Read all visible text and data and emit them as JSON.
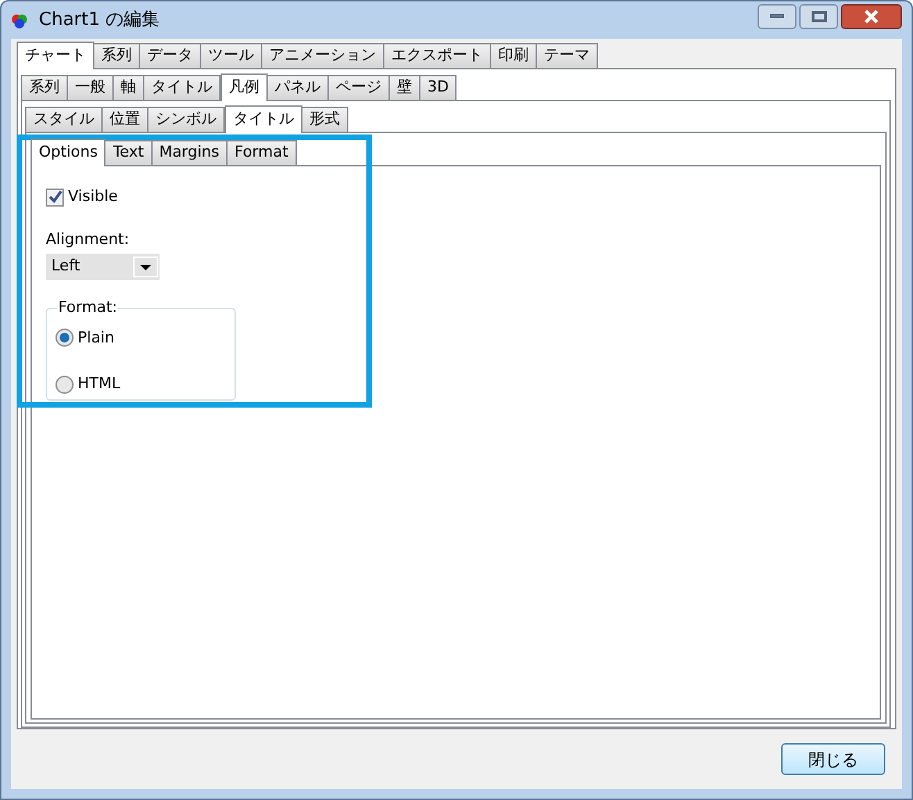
{
  "window": {
    "title": "Chart1 の編集"
  },
  "tabs": [
    {
      "label": "チャート",
      "selected": true
    },
    {
      "label": "系列",
      "selected": false
    },
    {
      "label": "データ",
      "selected": false
    },
    {
      "label": "ツール",
      "selected": false
    },
    {
      "label": "アニメーション",
      "selected": false
    },
    {
      "label": "エクスポート",
      "selected": false
    },
    {
      "label": "印刷",
      "selected": false
    },
    {
      "label": "テーマ",
      "selected": false
    }
  ],
  "chart_tabs": [
    {
      "label": "系列",
      "selected": false
    },
    {
      "label": "一般",
      "selected": false
    },
    {
      "label": "軸",
      "selected": false
    },
    {
      "label": "タイトル",
      "selected": false
    },
    {
      "label": "凡例",
      "selected": true
    },
    {
      "label": "パネル",
      "selected": false
    },
    {
      "label": "ページ",
      "selected": false
    },
    {
      "label": "壁",
      "selected": false
    },
    {
      "label": "3D",
      "selected": false
    }
  ],
  "legend_tabs": [
    {
      "label": "スタイル",
      "selected": false
    },
    {
      "label": "位置",
      "selected": false
    },
    {
      "label": "シンボル",
      "selected": false
    },
    {
      "label": "タイトル",
      "selected": true
    },
    {
      "label": "形式",
      "selected": false
    }
  ],
  "title_tabs": [
    {
      "label": "Options",
      "selected": true
    },
    {
      "label": "Text",
      "selected": false
    },
    {
      "label": "Margins",
      "selected": false
    },
    {
      "label": "Format",
      "selected": false
    }
  ],
  "options": {
    "visible": {
      "label": "Visible",
      "checked": true
    },
    "alignment": {
      "label": "Alignment:",
      "value": "Left"
    },
    "format": {
      "label": "Format:",
      "choices": [
        {
          "label": "Plain",
          "selected": true
        },
        {
          "label": "HTML",
          "selected": false
        }
      ]
    }
  },
  "buttons": [
    "閉じる"
  ]
}
